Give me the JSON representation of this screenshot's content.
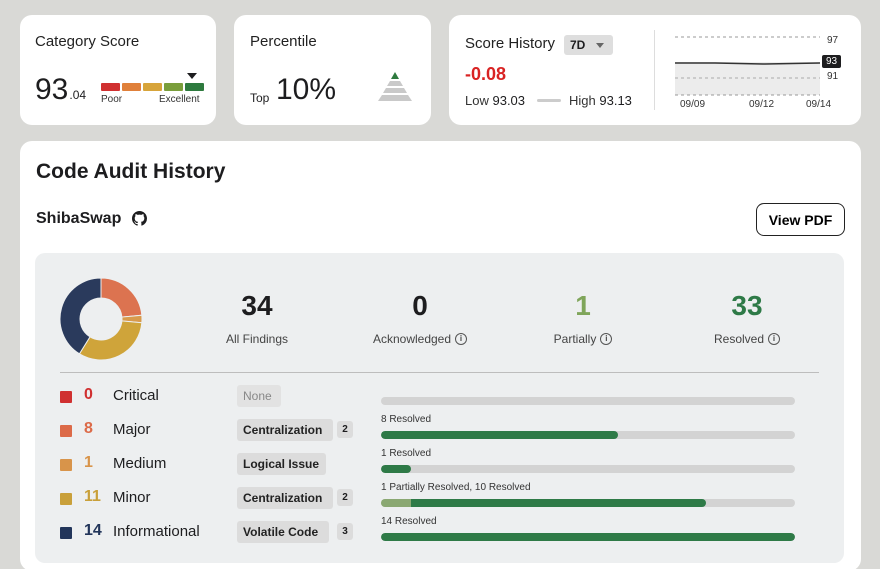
{
  "category_score": {
    "title": "Category Score",
    "value_int": "93",
    "value_dec": ".04",
    "poor_label": "Poor",
    "excellent_label": "Excellent",
    "scale_colors": [
      "#d03030",
      "#e0803a",
      "#d7a43a",
      "#7a9e3b",
      "#2e7a3e"
    ]
  },
  "percentile": {
    "title": "Percentile",
    "prefix": "Top",
    "value": "10%"
  },
  "score_history": {
    "title": "Score History",
    "range": "7D",
    "delta": "-0.08",
    "low_label": "Low",
    "low_value": "93.03",
    "high_label": "High",
    "high_value": "93.13",
    "y_ticks": [
      "97",
      "93",
      "91"
    ],
    "x_ticks": [
      "09/09",
      "09/12",
      "09/14"
    ]
  },
  "audit": {
    "title": "Code Audit History",
    "project": "ShibaSwap",
    "view_pdf": "View PDF",
    "stats": [
      {
        "value": "34",
        "label": "All Findings",
        "color": "#1d1d1f"
      },
      {
        "value": "0",
        "label": "Acknowledged",
        "color": "#1d1d1f"
      },
      {
        "value": "1",
        "label": "Partially",
        "color": "#7fa55a"
      },
      {
        "value": "33",
        "label": "Resolved",
        "color": "#2e7a47"
      }
    ],
    "donut": [
      {
        "name": "Major",
        "value": 8,
        "color": "#dc7350"
      },
      {
        "name": "Medium",
        "value": 1,
        "color": "#d89a4c"
      },
      {
        "name": "Minor",
        "value": 11,
        "color": "#cfa43a"
      },
      {
        "name": "Informational",
        "value": 14,
        "color": "#2a3a5c"
      }
    ],
    "rows": [
      {
        "count": "0",
        "severity": "Critical",
        "color": "#d03030",
        "tag": "None",
        "tag_count": "",
        "bar_label": "",
        "partial": 0,
        "resolved": 0,
        "total": 0
      },
      {
        "count": "8",
        "severity": "Major",
        "color": "#dc6a48",
        "tag": "Centralization",
        "tag_count": "2",
        "bar_label": "8 Resolved",
        "partial": 0,
        "resolved": 8,
        "total": 14
      },
      {
        "count": "1",
        "severity": "Medium",
        "color": "#d8944a",
        "tag": "Logical Issue",
        "tag_count": "",
        "bar_label": "1 Resolved",
        "partial": 0,
        "resolved": 1,
        "total": 14
      },
      {
        "count": "11",
        "severity": "Minor",
        "color": "#c9a03a",
        "tag": "Centralization",
        "tag_count": "2",
        "bar_label": "1 Partially Resolved, 10 Resolved",
        "partial": 1,
        "resolved": 10,
        "total": 14
      },
      {
        "count": "14",
        "severity": "Informational",
        "color": "#22355a",
        "tag": "Volatile Code",
        "tag_count": "3",
        "bar_label": "14 Resolved",
        "partial": 0,
        "resolved": 14,
        "total": 14
      }
    ]
  }
}
